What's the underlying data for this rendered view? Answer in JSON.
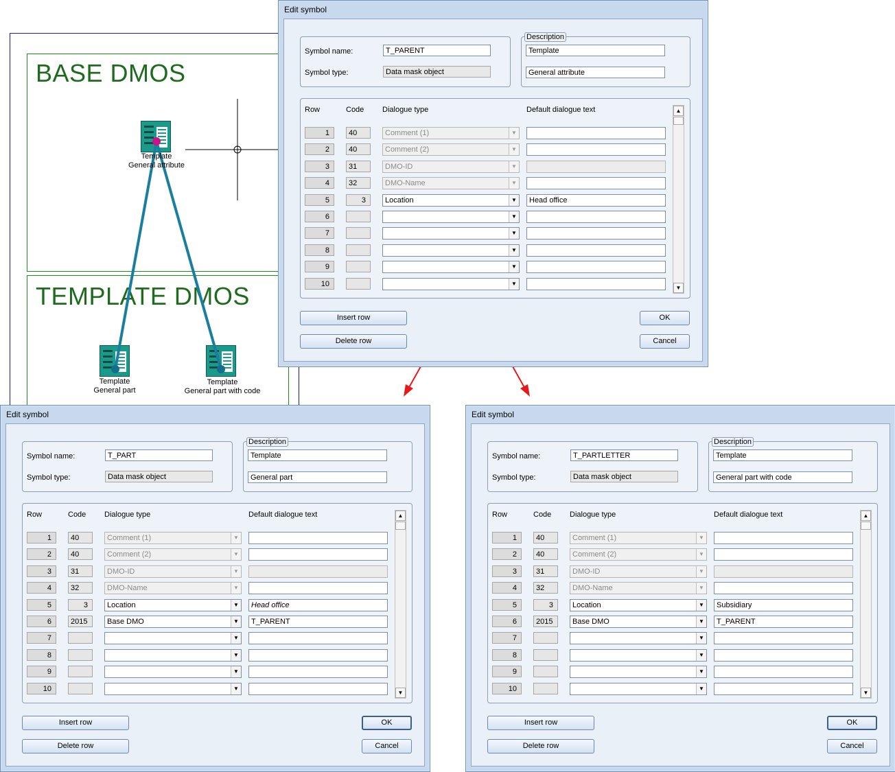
{
  "background": {
    "base_label": "BASE DMOS",
    "template_label": "TEMPLATE DMOS",
    "symbols": [
      {
        "line1": "Template",
        "line2": "General attribute"
      },
      {
        "line1": "Template",
        "line2": "General part"
      },
      {
        "line1": "Template",
        "line2": "General part with code"
      }
    ]
  },
  "colors": {
    "arrow": "#e81818",
    "connector": "#1a7ea0",
    "frame_green": "#1c8a1c",
    "label_green": "#1e6b1e"
  },
  "dialogs": [
    {
      "title": "Edit symbol",
      "symbol_name_label": "Symbol name:",
      "symbol_name": "T_PARENT",
      "symbol_type_label": "Symbol type:",
      "symbol_type": "Data mask object",
      "description_legend": "Description",
      "description1": "Template",
      "description2": "General attribute",
      "headers": {
        "row": "Row",
        "code": "Code",
        "dtype": "Dialogue type",
        "dtext": "Default dialogue text"
      },
      "rows": [
        {
          "row": "1",
          "code": "40",
          "dtype": "Comment (1)",
          "dtext": ""
        },
        {
          "row": "2",
          "code": "40",
          "dtype": "Comment (2)",
          "dtext": ""
        },
        {
          "row": "3",
          "code": "31",
          "dtype": "DMO-ID",
          "dtext": ""
        },
        {
          "row": "4",
          "code": "32",
          "dtype": "DMO-Name",
          "dtext": ""
        },
        {
          "row": "5",
          "code": "3",
          "dtype": "Location",
          "dtext": "Head office"
        },
        {
          "row": "6",
          "code": "",
          "dtype": "",
          "dtext": ""
        },
        {
          "row": "7",
          "code": "",
          "dtype": "",
          "dtext": ""
        },
        {
          "row": "8",
          "code": "",
          "dtype": "",
          "dtext": ""
        },
        {
          "row": "9",
          "code": "",
          "dtype": "",
          "dtext": ""
        },
        {
          "row": "10",
          "code": "",
          "dtype": "",
          "dtext": ""
        }
      ],
      "insert_row": "Insert row",
      "delete_row": "Delete row",
      "ok": "OK",
      "cancel": "Cancel"
    },
    {
      "title": "Edit symbol",
      "symbol_name_label": "Symbol name:",
      "symbol_name": "T_PART",
      "symbol_type_label": "Symbol type:",
      "symbol_type": "Data mask object",
      "description_legend": "Description",
      "description1": "Template",
      "description2": "General part",
      "headers": {
        "row": "Row",
        "code": "Code",
        "dtype": "Dialogue type",
        "dtext": "Default dialogue text"
      },
      "rows": [
        {
          "row": "1",
          "code": "40",
          "dtype": "Comment (1)",
          "dtext": ""
        },
        {
          "row": "2",
          "code": "40",
          "dtype": "Comment (2)",
          "dtext": ""
        },
        {
          "row": "3",
          "code": "31",
          "dtype": "DMO-ID",
          "dtext": ""
        },
        {
          "row": "4",
          "code": "32",
          "dtype": "DMO-Name",
          "dtext": ""
        },
        {
          "row": "5",
          "code": "3",
          "dtype": "Location",
          "dtext": "Head office"
        },
        {
          "row": "6",
          "code": "2015",
          "dtype": "Base DMO",
          "dtext": "T_PARENT"
        },
        {
          "row": "7",
          "code": "",
          "dtype": "",
          "dtext": ""
        },
        {
          "row": "8",
          "code": "",
          "dtype": "",
          "dtext": ""
        },
        {
          "row": "9",
          "code": "",
          "dtype": "",
          "dtext": ""
        },
        {
          "row": "10",
          "code": "",
          "dtype": "",
          "dtext": ""
        }
      ],
      "insert_row": "Insert row",
      "delete_row": "Delete row",
      "ok": "OK",
      "cancel": "Cancel"
    },
    {
      "title": "Edit symbol",
      "symbol_name_label": "Symbol name:",
      "symbol_name": "T_PARTLETTER",
      "symbol_type_label": "Symbol type:",
      "symbol_type": "Data mask object",
      "description_legend": "Description",
      "description1": "Template",
      "description2": "General part with code",
      "headers": {
        "row": "Row",
        "code": "Code",
        "dtype": "Dialogue type",
        "dtext": "Default dialogue text"
      },
      "rows": [
        {
          "row": "1",
          "code": "40",
          "dtype": "Comment (1)",
          "dtext": ""
        },
        {
          "row": "2",
          "code": "40",
          "dtype": "Comment (2)",
          "dtext": ""
        },
        {
          "row": "3",
          "code": "31",
          "dtype": "DMO-ID",
          "dtext": ""
        },
        {
          "row": "4",
          "code": "32",
          "dtype": "DMO-Name",
          "dtext": ""
        },
        {
          "row": "5",
          "code": "3",
          "dtype": "Location",
          "dtext": "Subsidiary"
        },
        {
          "row": "6",
          "code": "2015",
          "dtype": "Base DMO",
          "dtext": "T_PARENT"
        },
        {
          "row": "7",
          "code": "",
          "dtype": "",
          "dtext": ""
        },
        {
          "row": "8",
          "code": "",
          "dtype": "",
          "dtext": ""
        },
        {
          "row": "9",
          "code": "",
          "dtype": "",
          "dtext": ""
        },
        {
          "row": "10",
          "code": "",
          "dtype": "",
          "dtext": ""
        }
      ],
      "insert_row": "Insert row",
      "delete_row": "Delete row",
      "ok": "OK",
      "cancel": "Cancel"
    }
  ]
}
